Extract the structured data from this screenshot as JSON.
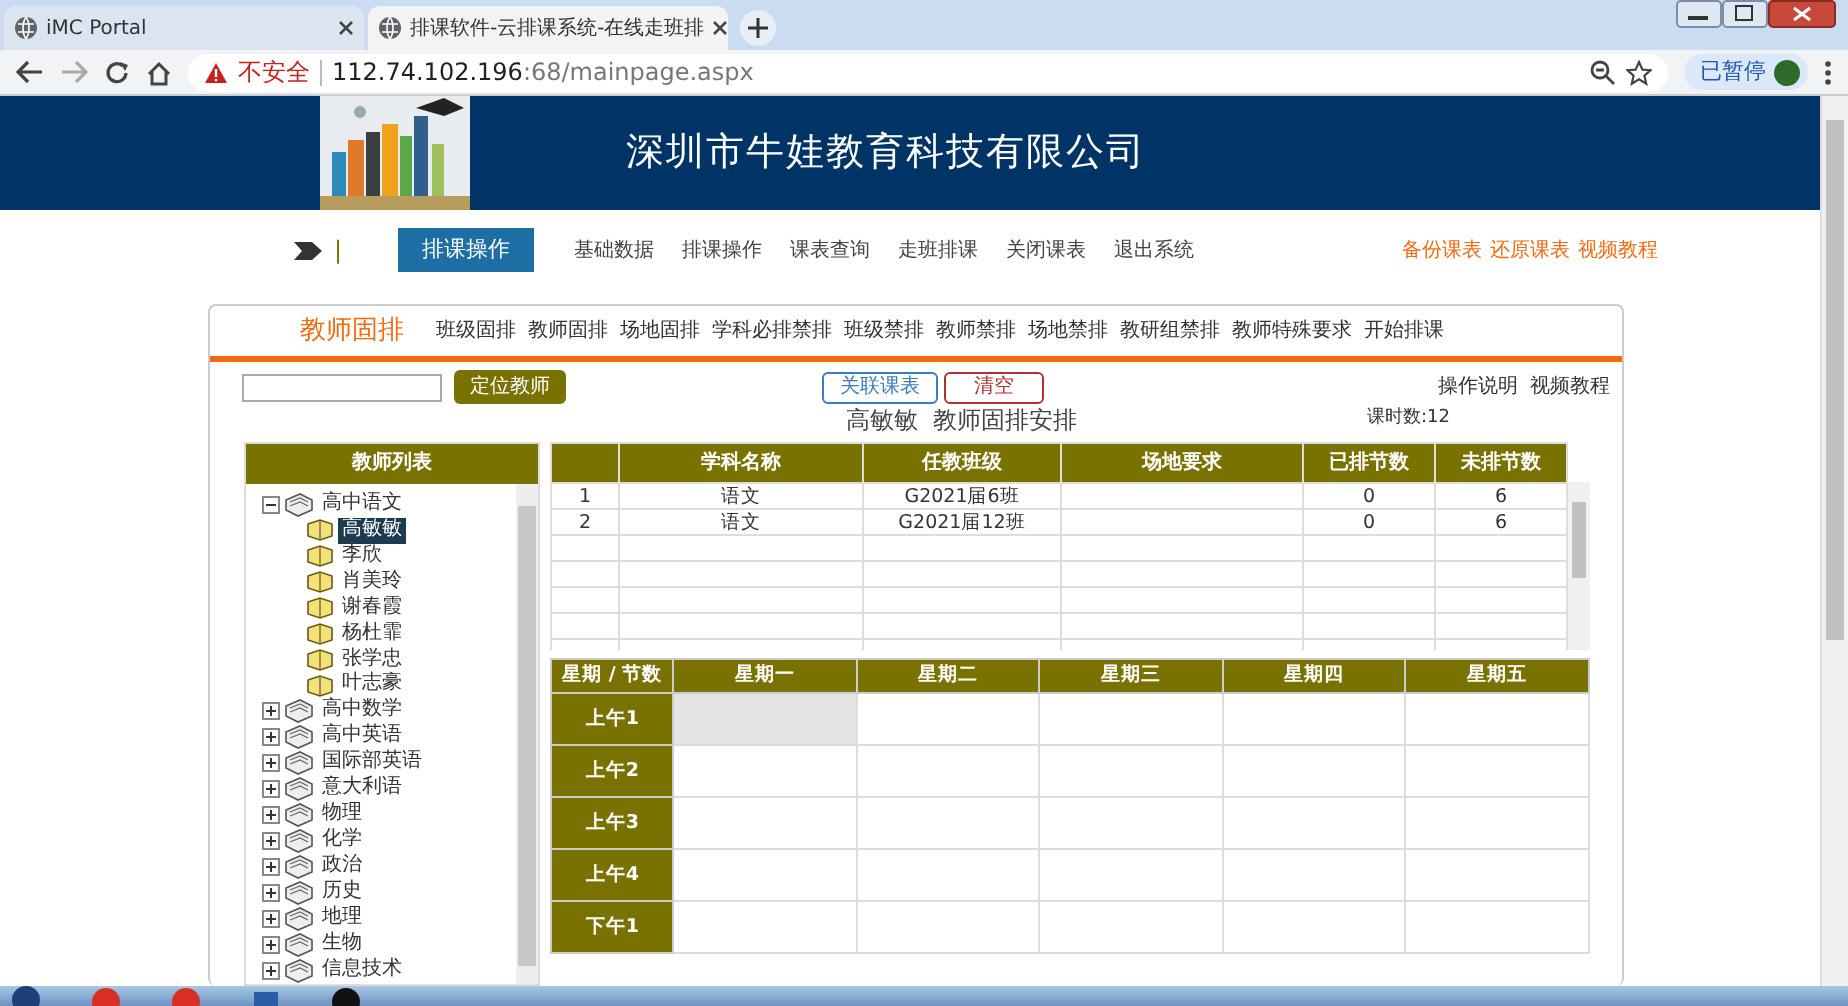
{
  "browser": {
    "tabs": [
      {
        "title": "iMC Portal",
        "selected": false
      },
      {
        "title": "排课软件-云排课系统-在线走班排",
        "selected": true
      }
    ],
    "url": {
      "warning": "不安全",
      "host": "112.74.102.196",
      "path": ":68/mainpage.aspx"
    },
    "profile_button": "已暂停"
  },
  "header": {
    "title": "深圳市牛娃教育科技有限公司"
  },
  "nav": {
    "separator": "|",
    "items": [
      {
        "label": "排课操作",
        "selected": true
      },
      {
        "label": "基础数据",
        "selected": false
      },
      {
        "label": "排课操作",
        "selected": false
      },
      {
        "label": "课表查询",
        "selected": false
      },
      {
        "label": "走班排课",
        "selected": false
      },
      {
        "label": "关闭课表",
        "selected": false
      },
      {
        "label": "退出系统",
        "selected": false
      }
    ],
    "extra_links": [
      "备份课表",
      "还原课表",
      "视频教程"
    ]
  },
  "panel": {
    "title": "教师固排",
    "subtabs": [
      "班级固排",
      "教师固排",
      "场地固排",
      "学科必排禁排",
      "班级禁排",
      "教师禁排",
      "场地禁排",
      "教研组禁排",
      "教师特殊要求",
      "开始排课"
    ],
    "locate_button": "定位教师",
    "actions": [
      {
        "label": "关联课表",
        "kind": "primary"
      },
      {
        "label": "清空",
        "kind": "danger"
      }
    ],
    "help_links": [
      "操作说明",
      "视频教程"
    ],
    "heading": "高敏敏  教师固排安排",
    "hours": "课时数:12"
  },
  "teacher_list": {
    "title": "教师列表",
    "groups": [
      {
        "label": "高中语文",
        "expanded": true,
        "children": [
          {
            "label": "高敏敏",
            "selected": true
          },
          {
            "label": "李欣",
            "selected": false
          },
          {
            "label": "肖美玲",
            "selected": false
          },
          {
            "label": "谢春霞",
            "selected": false
          },
          {
            "label": "杨杜霏",
            "selected": false
          },
          {
            "label": "张学忠",
            "selected": false
          },
          {
            "label": "叶志豪",
            "selected": false
          }
        ]
      },
      {
        "label": "高中数学",
        "expanded": false
      },
      {
        "label": "高中英语",
        "expanded": false
      },
      {
        "label": "国际部英语",
        "expanded": false
      },
      {
        "label": "意大利语",
        "expanded": false
      },
      {
        "label": "物理",
        "expanded": false
      },
      {
        "label": "化学",
        "expanded": false
      },
      {
        "label": "政治",
        "expanded": false
      },
      {
        "label": "历史",
        "expanded": false
      },
      {
        "label": "地理",
        "expanded": false
      },
      {
        "label": "生物",
        "expanded": false
      },
      {
        "label": "信息技术",
        "expanded": false
      }
    ]
  },
  "courses": {
    "columns": [
      "学科名称",
      "任教班级",
      "场地要求",
      "已排节数",
      "未排节数"
    ],
    "rows": [
      {
        "index": "1",
        "subject": "语文",
        "class": "G2021届6班",
        "scheduled": "0",
        "unscheduled": "6"
      },
      {
        "index": "2",
        "subject": "语文",
        "class": "G2021届12班",
        "scheduled": "0",
        "unscheduled": "6"
      }
    ]
  },
  "schedule": {
    "corner": "星期 / 节数",
    "days": [
      "星期一",
      "星期二",
      "星期三",
      "星期四",
      "星期五"
    ],
    "periods": [
      {
        "label": "上午1",
        "highlighted": [
          true,
          false,
          false,
          false,
          false
        ]
      },
      {
        "label": "上午2",
        "highlighted": [
          false,
          false,
          false,
          false,
          false
        ]
      },
      {
        "label": "上午3",
        "highlighted": [
          false,
          false,
          false,
          false,
          false
        ]
      },
      {
        "label": "上午4",
        "highlighted": [
          false,
          false,
          false,
          false,
          false
        ]
      },
      {
        "label": "下午1",
        "highlighted": [
          false,
          false,
          false,
          false,
          false
        ]
      }
    ]
  }
}
